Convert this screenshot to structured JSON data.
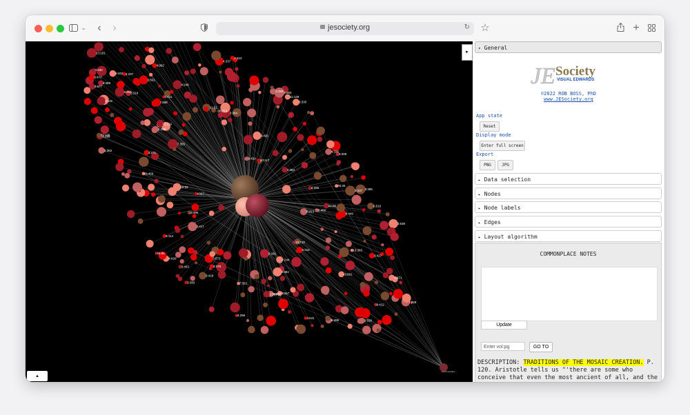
{
  "browser": {
    "url": "jesociety.org",
    "traffic_lights": [
      "#ff5f57",
      "#febc2e",
      "#28c840"
    ]
  },
  "graph": {
    "background": "#000000",
    "edge_color": "#bdbdbd",
    "node_colors": [
      "#e10000",
      "#f08070",
      "#9e1b28",
      "#7a4a30",
      "#c06060",
      "#b02030"
    ],
    "bottom_node_label": "r:commonplace",
    "labels": [
      "4:237",
      "r:488",
      "r3:691",
      "r3:456",
      "3:527",
      "4:677",
      "r:248",
      "25:95",
      "13:393",
      "r:244",
      "3:573",
      "3:459",
      "7:323",
      "8:471",
      "7:355",
      "9:499",
      "8:412",
      "22:55",
      "r:327",
      "8:413",
      "20:45",
      "5:114",
      "6:510",
      "8:470",
      "25:119",
      "3:530",
      "3:538",
      "11:51",
      "4:541",
      "4:491",
      "3:182",
      "3:284",
      "3:115",
      "23:105",
      "3:431",
      "8:469",
      "3:429",
      "20:117",
      "3:271",
      "4:249",
      "3:216",
      "18:93",
      "3:264",
      "11:139",
      "10:710",
      "3:289",
      "3:419",
      "3:395",
      "3:324",
      "3:561",
      "4:299",
      "4:337",
      "8:440",
      "4:208",
      "9:291",
      "4:992",
      "8:314",
      "23:191",
      "3:378",
      "8:402",
      "3:425",
      "3:295",
      "4:929",
      "5:316",
      "3:383",
      "3:330",
      "3:453",
      "3:385",
      "3:427",
      "3:384",
      "3:337",
      "3:399",
      "3:309",
      "3:382",
      "3:417",
      "3:367",
      "3:393",
      "3:359",
      "4:336"
    ]
  },
  "panel": {
    "general_label": "General",
    "logo_text_main": "JE",
    "logo_text_society": "Society",
    "logo_text_sub": "VISUAL EDWARDS",
    "credit": "©2022 ROB BOSS, PhD",
    "credit_link": "www.JESociety.org",
    "app_state_label": "App state",
    "reset_label": "Reset",
    "display_mode_label": "Display mode",
    "fullscreen_label": "Enter full screen",
    "export_label": "Export",
    "png_label": "PNG",
    "jpg_label": "JPG",
    "sections": [
      "Data selection",
      "Nodes",
      "Node labels",
      "Edges",
      "Layout algorithm"
    ],
    "notes_title": "COMMONPLACE NOTES",
    "update_label": "Update",
    "vol_placeholder": "Enter vol:pg",
    "goto_label": "GO TO",
    "desc_prefix": "DESCRIPTION: ",
    "desc_highlight": "TRADITIONS OF THE MOSAIC CREATION.",
    "desc_rest": " P. 120. Aristotle tells us \"'there are some who conceive that even the most ancient of all, and the most remote from"
  }
}
